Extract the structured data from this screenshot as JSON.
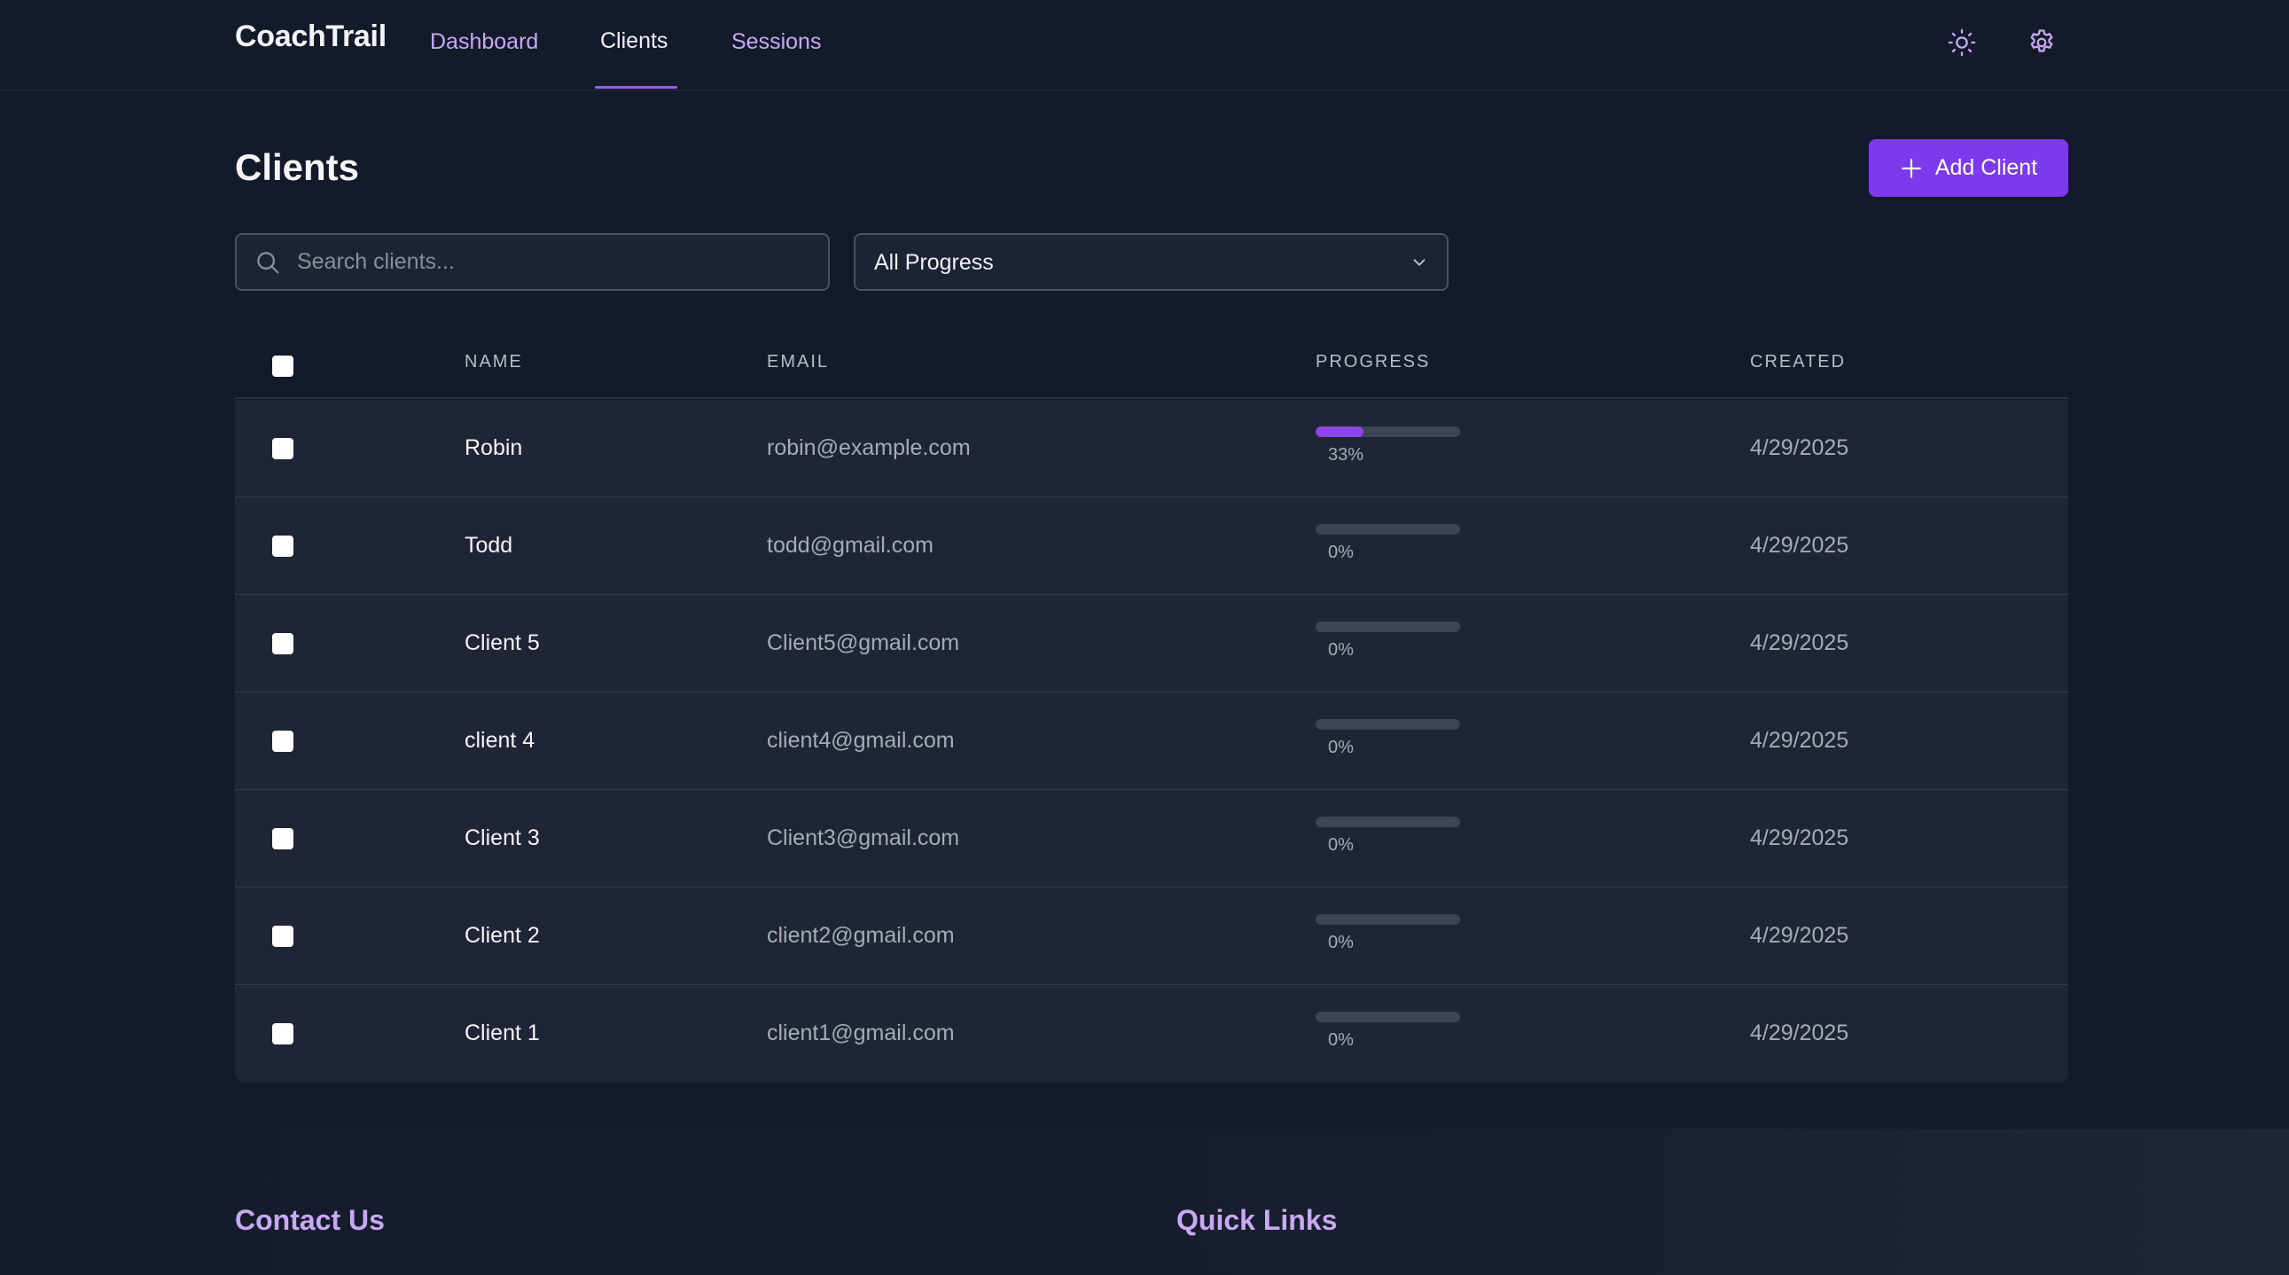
{
  "app": {
    "brand": "CoachTrail"
  },
  "nav": {
    "links": [
      {
        "label": "Dashboard"
      },
      {
        "label": "Clients"
      },
      {
        "label": "Sessions"
      }
    ],
    "active": "Clients",
    "icons": [
      "sun-icon",
      "gear-icon"
    ]
  },
  "page": {
    "title": "Clients",
    "add_button_label": "Add Client"
  },
  "filters": {
    "search_placeholder": "Search clients...",
    "search_value": "",
    "progress_select": "All Progress"
  },
  "table": {
    "headers": {
      "name": "NAME",
      "email": "EMAIL",
      "progress": "PROGRESS",
      "created": "CREATED"
    },
    "rows": [
      {
        "name": "Robin",
        "email": "robin@example.com",
        "progress": 0.33,
        "progress_label": "33%",
        "created": "4/29/2025"
      },
      {
        "name": "Todd",
        "email": "todd@gmail.com",
        "progress": 0,
        "progress_label": "0%",
        "created": "4/29/2025"
      },
      {
        "name": "Client 5",
        "email": "Client5@gmail.com",
        "progress": 0,
        "progress_label": "0%",
        "created": "4/29/2025"
      },
      {
        "name": "client 4",
        "email": "client4@gmail.com",
        "progress": 0,
        "progress_label": "0%",
        "created": "4/29/2025"
      },
      {
        "name": "Client 3",
        "email": "Client3@gmail.com",
        "progress": 0,
        "progress_label": "0%",
        "created": "4/29/2025"
      },
      {
        "name": "Client 2",
        "email": "client2@gmail.com",
        "progress": 0,
        "progress_label": "0%",
        "created": "4/29/2025"
      },
      {
        "name": "Client 1",
        "email": "client1@gmail.com",
        "progress": 0,
        "progress_label": "0%",
        "created": "4/29/2025"
      }
    ]
  },
  "footer": {
    "contact_heading": "Contact Us",
    "links_heading": "Quick Links"
  },
  "colors": {
    "background": "#131a2a",
    "accent": "#7c3aed",
    "nav_link": "#c9a8f5",
    "progress_fill": "#8b45e8"
  }
}
